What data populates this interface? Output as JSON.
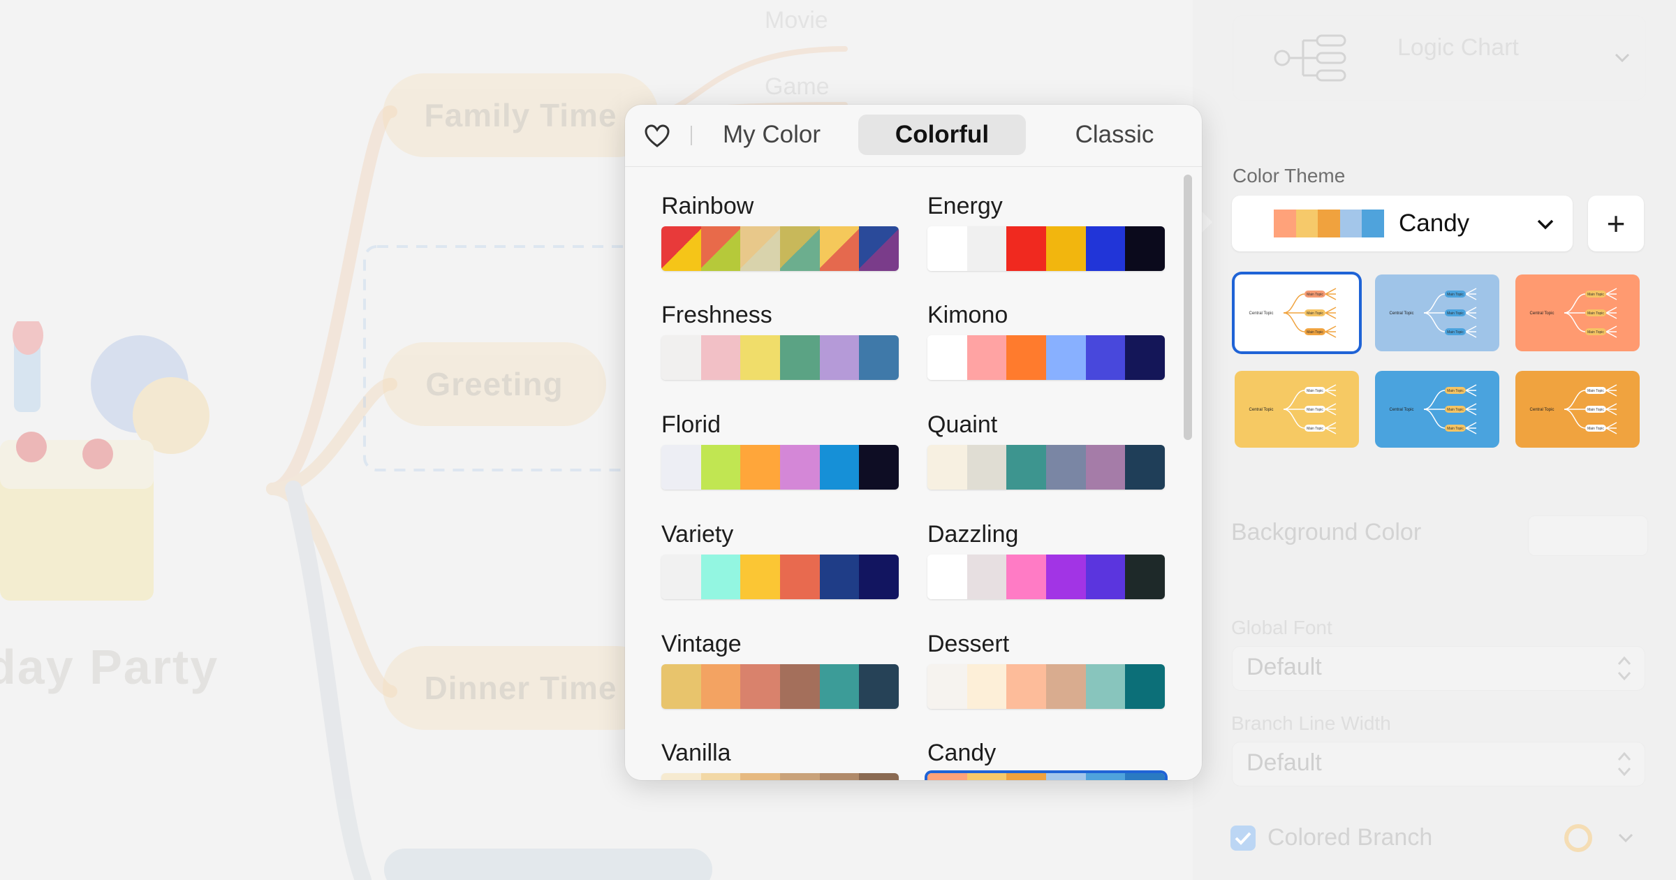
{
  "canvas": {
    "leaves": [
      "Movie",
      "Game"
    ],
    "nodes": [
      "Family Time",
      "Greeting",
      "Dinner Time"
    ],
    "central_partial": "day Party"
  },
  "panel": {
    "layout_select": "Logic Chart",
    "color_theme_label": "Color Theme",
    "selected_theme": "Candy",
    "selected_theme_colors": [
      "#ffa27a",
      "#f6c96a",
      "#f0a23e",
      "#a3c6ea",
      "#4fa3dc"
    ],
    "add_button": "+",
    "background_color_label": "Background Color",
    "global_font_label": "Global Font",
    "global_font_value": "Default",
    "branch_width_label": "Branch Line Width",
    "branch_width_value": "Default",
    "colored_branch_label": "Colored Branch",
    "colored_branch_checked": true,
    "thumbnails": [
      {
        "bg": "#ffffff",
        "center_label": "Central Topic",
        "topic_label": "Main Topic",
        "topic_colors": [
          "#f59a72",
          "#f5c463",
          "#f0a33f"
        ],
        "selected": true
      },
      {
        "bg": "#9fc4e8",
        "center_label": "Central Topic",
        "topic_label": "Main Topic",
        "topic_colors": [
          "#4aa3de",
          "#4aa3de",
          "#4aa3de"
        ],
        "selected": false
      },
      {
        "bg": "#ff9a70",
        "center_label": "Central Topic",
        "topic_label": "Main Topic",
        "topic_colors": [
          "#f5c463",
          "#f5c463",
          "#f5c463"
        ],
        "selected": false
      },
      {
        "bg": "#f6c963",
        "center_label": "Central Topic",
        "topic_label": "Main Topic",
        "topic_colors": [
          "#ffffff",
          "#ffffff",
          "#ffffff"
        ],
        "selected": false
      },
      {
        "bg": "#4aa3de",
        "center_label": "Central Topic",
        "topic_label": "Main Topic",
        "topic_colors": [
          "#f5c463",
          "#f5c463",
          "#f5c463"
        ],
        "selected": false
      },
      {
        "bg": "#f0a33f",
        "center_label": "Central Topic",
        "topic_label": "Main Topic",
        "topic_colors": [
          "#ffffff",
          "#ffffff",
          "#ffffff"
        ],
        "selected": false
      }
    ]
  },
  "popover": {
    "tabs": [
      "My Color",
      "Colorful",
      "Classic"
    ],
    "active_tab": "Colorful",
    "themes": [
      {
        "name": "Rainbow",
        "colors": [
          "#f5c518",
          "#b6c93a",
          "#d9d3ac",
          "#6cae8e",
          "#e5694e",
          "#7a3c8a"
        ],
        "diagonal": [
          "#e83a3a",
          "#e86a4a",
          "#e8c88a",
          "#c8b85a",
          "#f5c85a",
          "#2a4a9a"
        ]
      },
      {
        "name": "Energy",
        "colors": [
          "#ffffff",
          "#f0f0f0",
          "#f0291f",
          "#f2b60e",
          "#2135d8",
          "#0b0a1c"
        ]
      },
      {
        "name": "Freshness",
        "colors": [
          "#f1f0ef",
          "#f2c0c6",
          "#f0dd6a",
          "#5ba384",
          "#b59ad8",
          "#3f79a9"
        ]
      },
      {
        "name": "Kimono",
        "colors": [
          "#ffffff",
          "#ffa3a3",
          "#ff7b2d",
          "#88b0ff",
          "#4848dc",
          "#141658"
        ]
      },
      {
        "name": "Florid",
        "colors": [
          "#edeef4",
          "#c1e652",
          "#ffa63a",
          "#d487d7",
          "#1690d7",
          "#0e0d24"
        ]
      },
      {
        "name": "Quaint",
        "colors": [
          "#f7f0e1",
          "#e0ddd3",
          "#3d958f",
          "#7a86a4",
          "#a57ca8",
          "#1f3e58"
        ]
      },
      {
        "name": "Variety",
        "colors": [
          "#f1f1f1",
          "#93f6e1",
          "#fbc634",
          "#e86a4f",
          "#1f3d87",
          "#121560"
        ]
      },
      {
        "name": "Dazzling",
        "colors": [
          "#ffffff",
          "#e7dfe1",
          "#ff7bc5",
          "#a234e5",
          "#5b35de",
          "#1e2929"
        ]
      },
      {
        "name": "Vintage",
        "colors": [
          "#e8c46c",
          "#f3a362",
          "#d9826c",
          "#a46f5b",
          "#3c9c98",
          "#264257"
        ]
      },
      {
        "name": "Dessert",
        "colors": [
          "#f6f3ef",
          "#fdefd8",
          "#fdbc9a",
          "#d9ac8f",
          "#88c5bd",
          "#0c6f78"
        ]
      },
      {
        "name": "Vanilla",
        "colors": [
          "#f6ead0",
          "#f2d8a6",
          "#e6b980",
          "#c9a27a",
          "#b08a6a",
          "#8a6a52"
        ]
      },
      {
        "name": "Candy",
        "colors": [
          "#ffa27a",
          "#f6c96a",
          "#f0a23e",
          "#a3c6ea",
          "#4fa3dc",
          "#2a7ac2"
        ],
        "selected": true
      }
    ]
  }
}
